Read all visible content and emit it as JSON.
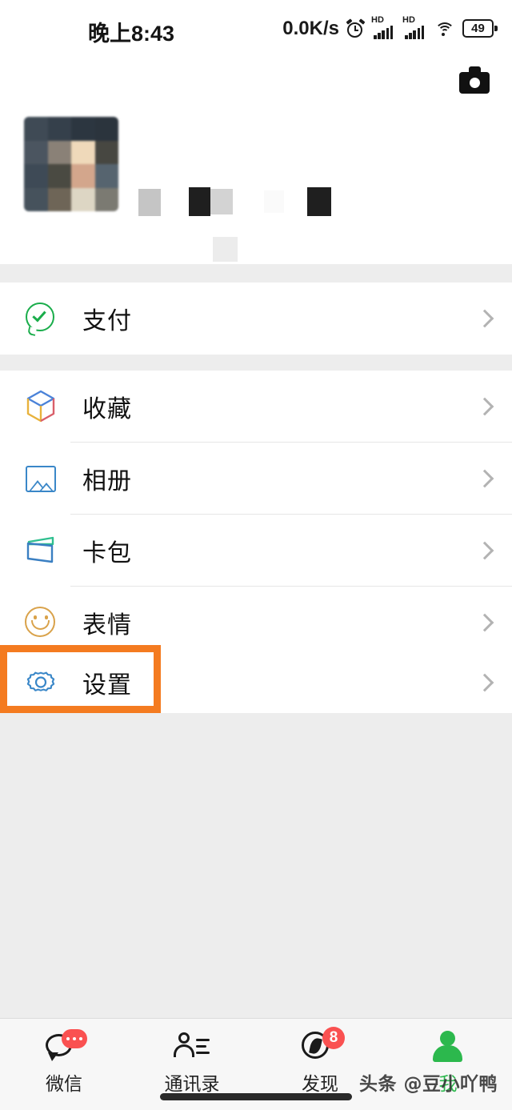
{
  "status_bar": {
    "time": "晚上8:43",
    "network_speed": "0.0K/s",
    "alarm_icon": "alarm-clock-icon",
    "sim1_label": "HD",
    "sim2_label": "HD",
    "wifi_icon": "wifi-icon",
    "battery_level": "49"
  },
  "header": {
    "camera_icon": "camera-icon",
    "avatar": "user-avatar-pixelated",
    "nickname_redacted": "",
    "wechat_id_redacted": ""
  },
  "menu_groups": [
    {
      "rows": [
        {
          "label": "支付",
          "icon": "pay-icon",
          "chevron": "chevron-right-icon"
        }
      ]
    },
    {
      "rows": [
        {
          "label": "收藏",
          "icon": "favorites-icon",
          "chevron": "chevron-right-icon"
        },
        {
          "label": "相册",
          "icon": "album-icon",
          "chevron": "chevron-right-icon"
        },
        {
          "label": "卡包",
          "icon": "cards-icon",
          "chevron": "chevron-right-icon"
        },
        {
          "label": "表情",
          "icon": "stickers-icon",
          "chevron": "chevron-right-icon"
        }
      ]
    },
    {
      "rows": [
        {
          "label": "设置",
          "icon": "settings-gear-icon",
          "chevron": "chevron-right-icon",
          "highlighted": true
        }
      ]
    }
  ],
  "highlight": {
    "color": "#f47b20",
    "target": "设置"
  },
  "tab_bar": {
    "items": [
      {
        "label": "微信",
        "icon": "chat-bubble-icon",
        "badge": "•••",
        "active": false
      },
      {
        "label": "通讯录",
        "icon": "contacts-icon",
        "badge": "",
        "active": false
      },
      {
        "label": "发现",
        "icon": "compass-icon",
        "badge": "8",
        "active": false
      },
      {
        "label": "我",
        "icon": "person-icon",
        "badge": "",
        "active": true
      }
    ],
    "active_color": "#2cb84d",
    "badge_color": "#fa5151"
  },
  "watermark": "头条 @豆小吖鸭"
}
